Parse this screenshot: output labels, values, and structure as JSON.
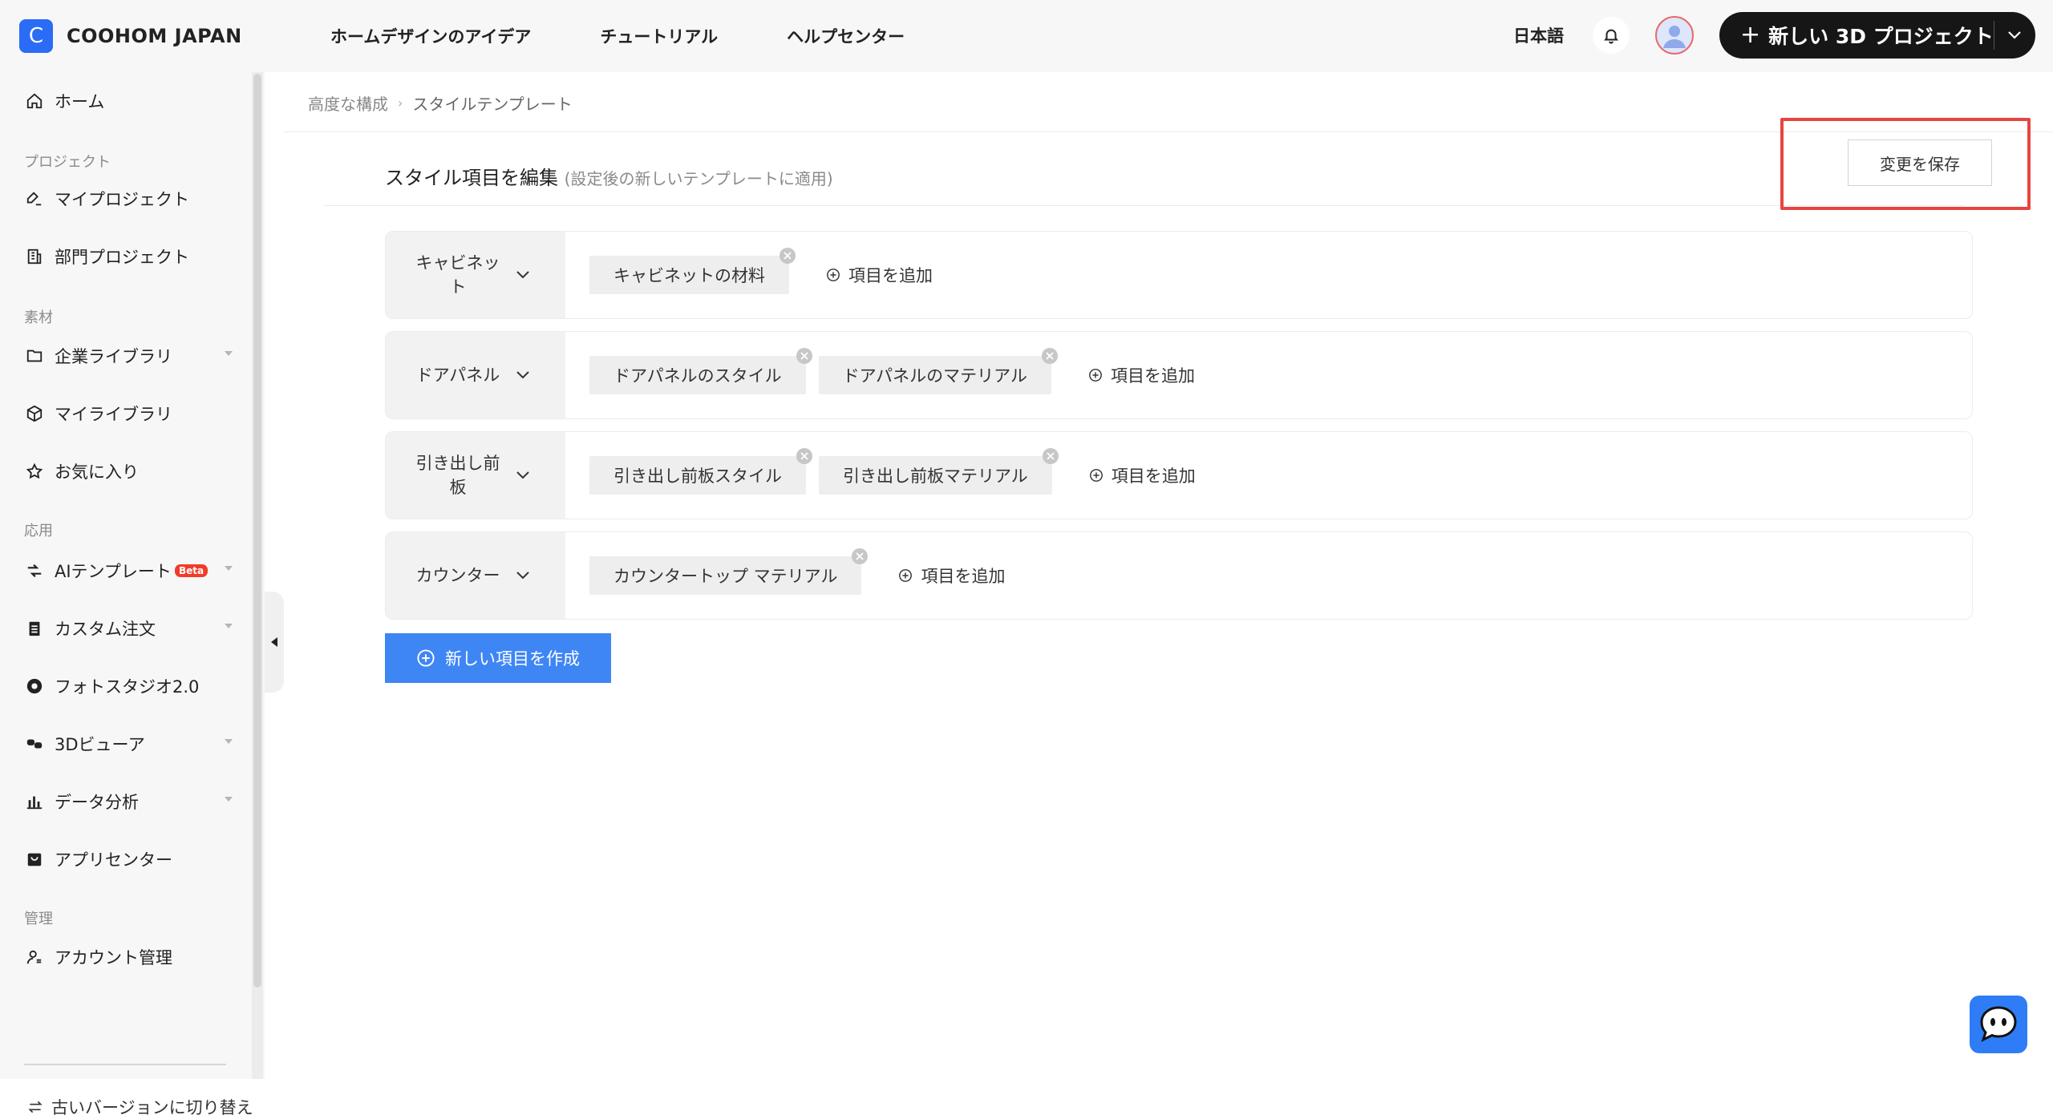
{
  "brand": {
    "logo_letter": "C",
    "name": "COOHOM JAPAN"
  },
  "topnav": [
    "ホームデザインのアイデア",
    "チュートリアル",
    "ヘルプセンター"
  ],
  "header": {
    "language": "日本語",
    "new_project_label": "新しい 3D プロジェクト"
  },
  "sidebar": {
    "home": "ホーム",
    "section_project": "プロジェクト",
    "my_projects": "マイプロジェクト",
    "dept_projects": "部門プロジェクト",
    "section_material": "素材",
    "enterprise_library": "企業ライブラリ",
    "my_library": "マイライブラリ",
    "favorites": "お気に入り",
    "section_app": "応用",
    "ai_template": "AIテンプレート",
    "beta": "Beta",
    "custom_order": "カスタム注文",
    "photo_studio": "フォトスタジオ2.0",
    "viewer_3d": "3Dビューア",
    "data_analysis": "データ分析",
    "app_center": "アプリセンター",
    "section_manage": "管理",
    "account_manage": "アカウント管理",
    "old_version": "古いバージョンに切り替え"
  },
  "breadcrumb": {
    "parent": "高度な構成",
    "current": "スタイルテンプレート"
  },
  "editor": {
    "title": "スタイル項目を編集",
    "hint": "(設定後の新しいテンプレートに適用)",
    "save_label": "変更を保存",
    "add_item_label": "項目を追加",
    "create_label": "新しい項目を作成",
    "rows": [
      {
        "name": "キャビネット",
        "tags": [
          "キャビネットの材料"
        ]
      },
      {
        "name": "ドアパネル",
        "tags": [
          "ドアパネルのスタイル",
          "ドアパネルのマテリアル"
        ]
      },
      {
        "name": "引き出し前板",
        "tags": [
          "引き出し前板スタイル",
          "引き出し前板マテリアル"
        ]
      },
      {
        "name": "カウンター",
        "tags": [
          "カウンタートップ マテリアル"
        ]
      }
    ]
  },
  "colors": {
    "accent": "#3f86f5",
    "highlight": "#e5463f",
    "brand": "#2b6cf6"
  }
}
